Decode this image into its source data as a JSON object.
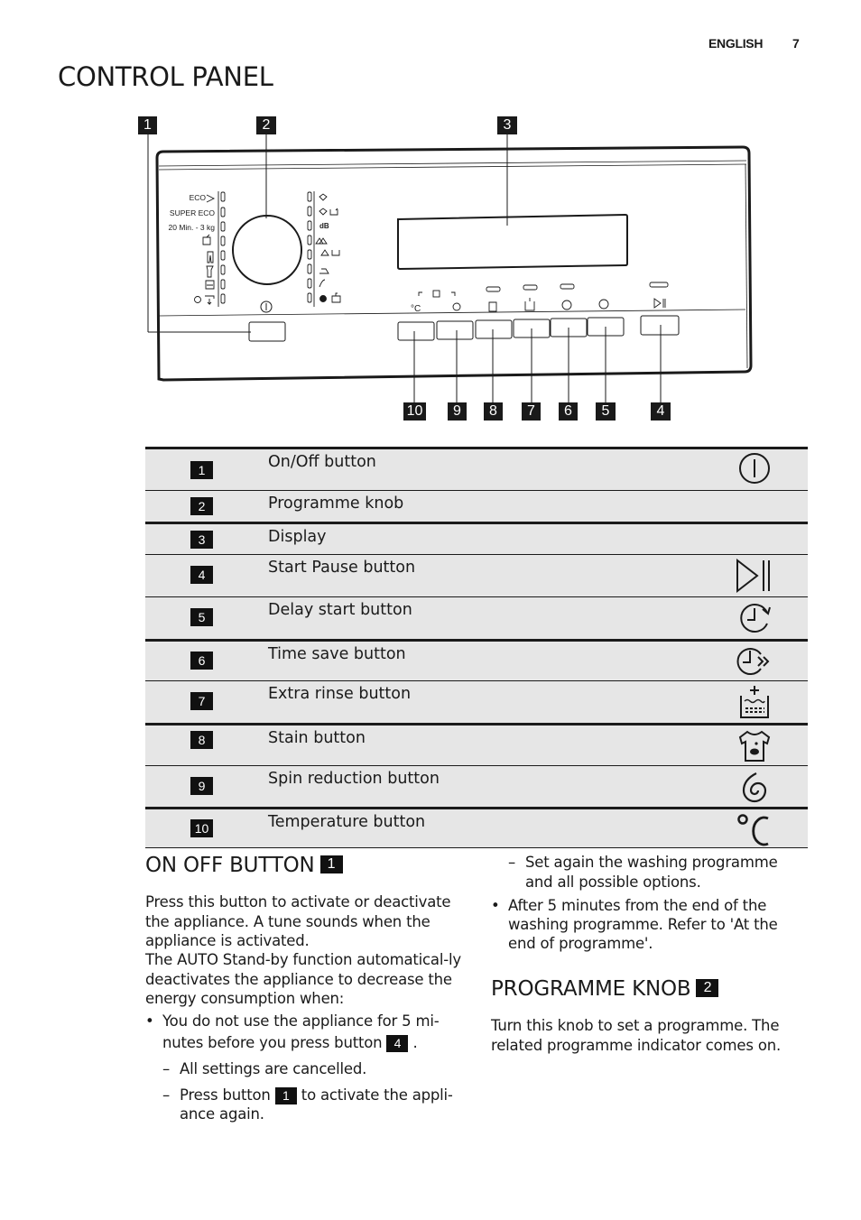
{
  "header": {
    "language": "ENGLISH",
    "page_number": "7"
  },
  "page_title": "CONTROL PANEL",
  "diagram": {
    "callouts_top": [
      "1",
      "2",
      "3"
    ],
    "callouts_bottom": [
      "10",
      "9",
      "8",
      "7",
      "6",
      "5",
      "4"
    ],
    "left_programmes": [
      "ECO",
      "SUPER ECO",
      "20 Min. - 3 kg"
    ],
    "display_symbol_dB": "dB",
    "temperature_symbol": "°C"
  },
  "table": {
    "rows": [
      {
        "num": "1",
        "label": "On/Off button",
        "icon": "power-icon"
      },
      {
        "num": "2",
        "label": "Programme knob",
        "icon": ""
      },
      {
        "num": "3",
        "label": "Display",
        "icon": ""
      },
      {
        "num": "4",
        "label": "Start Pause button",
        "icon": "play-pause-icon"
      },
      {
        "num": "5",
        "label": "Delay start button",
        "icon": "delay-clock-icon"
      },
      {
        "num": "6",
        "label": "Time save button",
        "icon": "time-save-icon"
      },
      {
        "num": "7",
        "label": "Extra rinse button",
        "icon": "extra-rinse-icon"
      },
      {
        "num": "8",
        "label": "Stain button",
        "icon": "stain-shirt-icon"
      },
      {
        "num": "9",
        "label": "Spin reduction button",
        "icon": "spin-icon"
      },
      {
        "num": "10",
        "label": "Temperature button",
        "icon": "temperature-icon"
      }
    ]
  },
  "on_off_section": {
    "heading": "ON OFF BUTTON",
    "heading_ref": "1",
    "para1": "Press this button to activate or deactivate the appliance. A tune sounds when the appliance is activated.",
    "para2": "The AUTO Stand-by function automatical-ly deactivates the appliance to decrease the energy consumption when:",
    "bullet1_a": "You do not use the appliance for 5 mi-",
    "bullet1_b": "nutes before you press button",
    "bullet1_ref": "4",
    "bullet1_end": ".",
    "dash1": "All settings are cancelled.",
    "dash2_a": "Press button",
    "dash2_ref": "1",
    "dash2_b": "to activate the appli-",
    "dash2_c": "ance again.",
    "dash3_a": "Set again the washing programme",
    "dash3_b": "and all possible options.",
    "bullet2_a": "After 5 minutes from the end of the",
    "bullet2_b": "washing programme. Refer to 'At the",
    "bullet2_c": "end of programme'."
  },
  "programme_knob_section": {
    "heading": "PROGRAMME KNOB",
    "heading_ref": "2",
    "para": "Turn this knob to set a programme. The related programme indicator comes on."
  }
}
